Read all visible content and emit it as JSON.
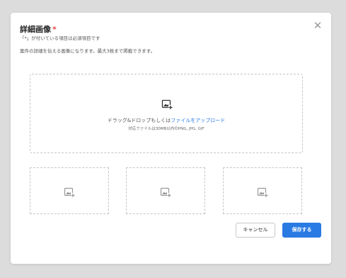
{
  "modal": {
    "title": "詳細画像",
    "required_mark": "*",
    "close_icon": "close-icon",
    "note_required": "「*」が付いている項目は必須項目です",
    "description": "案件の詳細を伝える画像になります。最大3枚まで掲載できます。"
  },
  "dropzone": {
    "icon": "add-image-icon",
    "text_prefix": "ドラッグ&ドロップもしくは",
    "upload_link": "ファイルをアップロード",
    "formats_note": "対応ファイルは30MB以内のPNG, JPG, GIF"
  },
  "slots": [
    {
      "icon": "add-image-icon"
    },
    {
      "icon": "add-image-icon"
    },
    {
      "icon": "add-image-icon"
    }
  ],
  "actions": {
    "cancel_label": "キャンセル",
    "save_label": "保存する"
  },
  "colors": {
    "accent": "#2a7ae4",
    "required": "#e5484d",
    "dashed_border": "#c6c6c6"
  }
}
